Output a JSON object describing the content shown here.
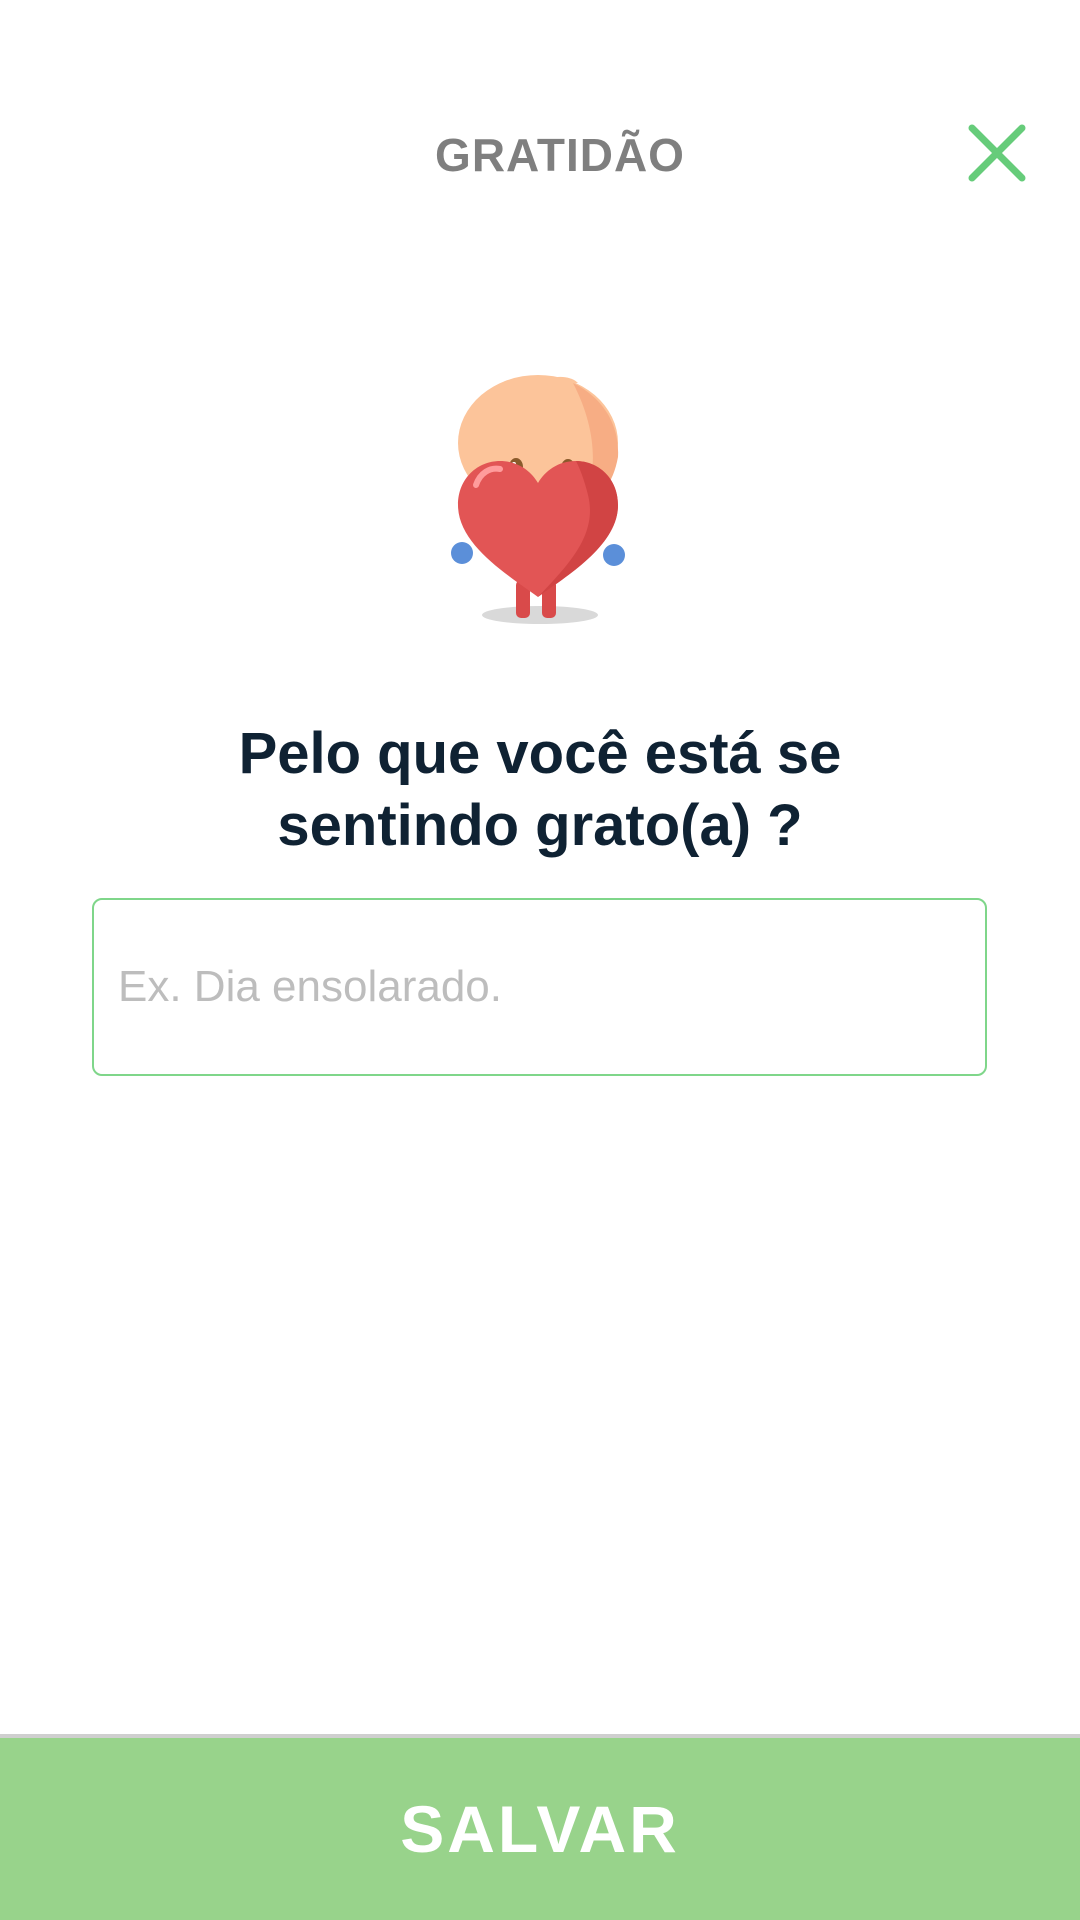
{
  "header": {
    "title": "GRATIDÃO",
    "close_icon": "close-icon",
    "accent_color": "#66cc7a"
  },
  "illustration": {
    "icon": "heart-mascot-icon"
  },
  "main": {
    "question_line1": "Pelo que você está se",
    "question_line2": "sentindo grato(a) ?",
    "input": {
      "placeholder": "Ex. Dia ensolarado.",
      "value": ""
    }
  },
  "footer": {
    "save_label": "SALVAR",
    "button_color": "#98d38b"
  }
}
